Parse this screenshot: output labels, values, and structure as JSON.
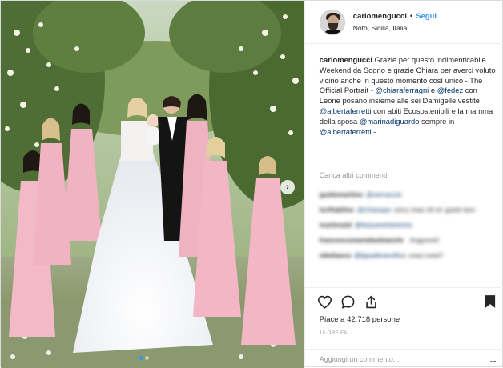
{
  "post": {
    "photo_alt": "Official Portrait",
    "carousel": {
      "total": 2,
      "active": 1
    }
  },
  "header": {
    "username": "carlomengucci",
    "separator": "•",
    "follow_label": "Segui",
    "location": "Noto, Sicilia, Italia"
  },
  "caption": {
    "username": "carlomengucci",
    "text_1": "Grazie per questo indimenticabile Weekend da Sogno e grazie Chiara per averci voluto vicino anche in questo momento così unico - The Official Portrait - ",
    "mention_1": "@chiaraferragni",
    "text_2": " e ",
    "mention_2": "@fedez",
    "text_3": " con Leone posano insieme alle sei Damigelle vestite ",
    "mention_3": "@albertaferretti",
    "text_4": " con abiti Ecosostenibili e la mamma della sposa ",
    "mention_4": "@marinadiguardo",
    "text_5": " sempre in ",
    "mention_5": "@albertaferretti",
    "text_6": " -"
  },
  "load_more_comments": "Carica altri commenti",
  "comments": [
    {
      "user": "guidomartino",
      "mention": "@vercaccio",
      "text": ""
    },
    {
      "user": "lorifiabline",
      "mention": "@chiasspe",
      "text": "sorry mae oll orr goelo bon"
    },
    {
      "user": "marlenaid",
      "mention": "@lerjuanerlaminira",
      "text": ""
    },
    {
      "user": "francescomariafasbianchi",
      "mention": "",
      "text": "Auguroni!"
    },
    {
      "user": "otteliasca",
      "mention": "@lpjuaferanofica",
      "text": "cosa cosa?"
    }
  ],
  "actions": {
    "like_icon": "heart-icon",
    "comment_icon": "comment-icon",
    "share_icon": "share-icon",
    "save_icon": "bookmark-icon"
  },
  "likes_text": "Piace a 42.718 persone",
  "timestamp": "15 ORE FA",
  "add_comment": {
    "placeholder": "Aggiungi un commento...",
    "more_icon": "..."
  },
  "colors": {
    "link": "#3897f0",
    "mention": "#003569",
    "muted": "#999999",
    "text": "#262626"
  }
}
